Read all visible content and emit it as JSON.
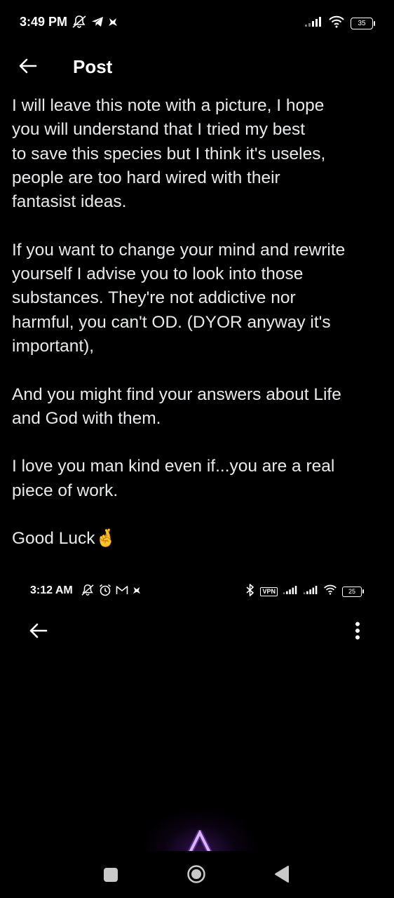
{
  "status_bar": {
    "time": "3:49 PM",
    "battery": "35",
    "icons_left": [
      "muted-icon",
      "telegram-icon",
      "app-notification-icon"
    ],
    "icons_right": [
      "signal-icon",
      "wifi-icon",
      "battery-icon"
    ]
  },
  "header": {
    "title": "Post"
  },
  "post": {
    "paragraphs": [
      "I will leave this note with a picture, I hope\nyou will understand that I tried my best\nto save this species but I think it's useles,\npeople are too hard wired with their\nfantasist ideas.",
      "If you want to change your mind and rewrite\nyourself I advise you to look into those\nsubstances. They're not addictive nor\nharmful, you can't OD. (DYOR anyway it's\nimportant),",
      "And you might find your answers about Life\nand God with them.",
      "I love you man kind even if...you are a real\npiece of work.",
      "Good Luck🤞"
    ]
  },
  "embedded_screenshot": {
    "time": "3:12 AM",
    "battery": "25",
    "vpn_label": "VPN",
    "icons_left": [
      "muted-icon",
      "alarm-icon",
      "gmail-icon",
      "app-notification-icon"
    ],
    "icons_right": [
      "bluetooth-icon",
      "vpn-icon",
      "signal-icon",
      "signal-icon",
      "wifi-icon",
      "battery-icon"
    ]
  },
  "colors": {
    "background": "#000000",
    "text": "#e7e9ea",
    "accent_glow": "#b070ff"
  }
}
